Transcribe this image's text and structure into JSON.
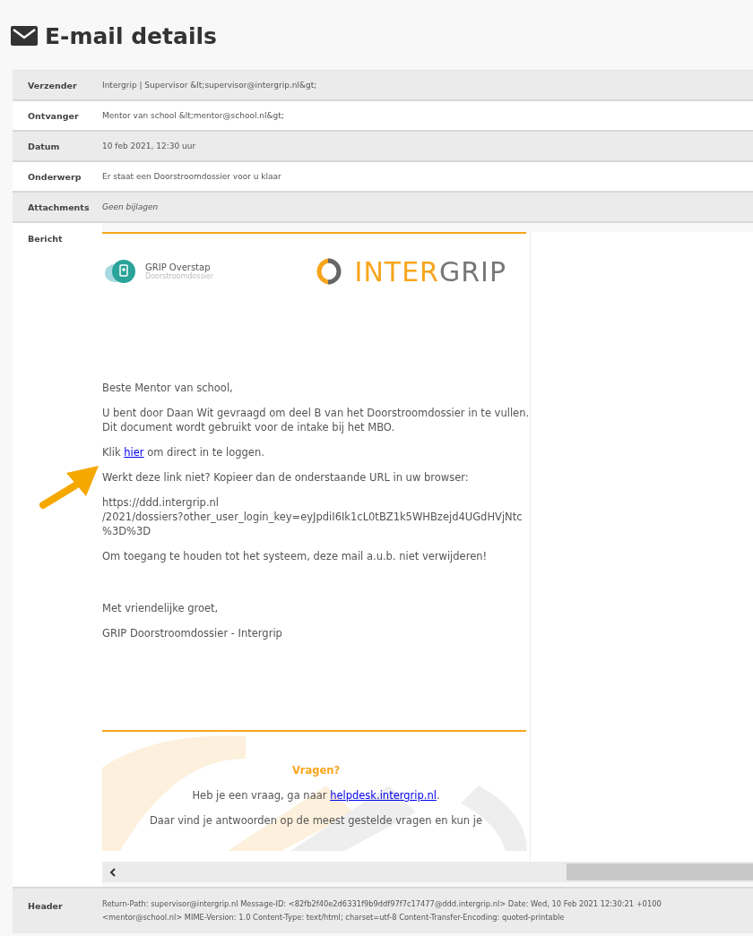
{
  "page_title": "E-mail details",
  "fields": [
    {
      "label": "Verzender",
      "value": "Intergrip | Supervisor &lt;supervisor@intergrip.nl&gt;",
      "kind": "text"
    },
    {
      "label": "Ontvanger",
      "value": "Mentor van school &lt;mentor@school.nl&gt;",
      "kind": "text"
    },
    {
      "label": "Datum",
      "value": "10 feb 2021, 12:30 uur",
      "kind": "text"
    },
    {
      "label": "Onderwerp",
      "value": "Er staat een Doorstroomdossier voor u klaar",
      "kind": "text"
    },
    {
      "label": "Attachments",
      "value": "Geen bijlagen",
      "kind": "none"
    }
  ],
  "message": {
    "label": "Bericht",
    "brand": {
      "name": "GRIP Overstap",
      "subtitle": "Doorstroomdossier",
      "wordmark": [
        "INTER",
        "GRIP"
      ]
    },
    "greeting": "Beste Mentor van school,",
    "intro": "U bent door Daan Wit gevraagd om deel B van het Doorstroomdossier in te vullen. Dit document wordt gebruikt voor de intake bij het MBO.",
    "login": {
      "before": "Klik ",
      "link": "hier",
      "after": " om direct in te loggen."
    },
    "fallback": "Werkt deze link niet? Kopieer dan de onderstaande URL in uw browser:",
    "url_lines": [
      "https://ddd.intergrip.nl",
      "/2021/dossiers?other_user_login_key=eyJpdiI6Ik1cL0tBZ1k5WHBzejd4UGdHVjNtc",
      "%3D%3D"
    ],
    "notice": "Om toegang te houden tot het systeem, deze mail a.u.b. niet verwijderen!",
    "closing": "Met vriendelijke groet,",
    "signature": "GRIP Doorstroomdossier - Intergrip",
    "footer": {
      "title": "Vragen?",
      "help_before": "Heb je een vraag, ga naar ",
      "help_link": "helpdesk.intergrip.nl",
      "help_after": ".",
      "more": "Daar vind je antwoorden op de meest gestelde vragen en kun je"
    }
  },
  "header": {
    "label": "Header",
    "lines": [
      "Return-Path: supervisor@intergrip.nl Message-ID: <82fb2f40e2d6331f9b9ddf97f7c17477@ddd.intergrip.nl> Date: Wed, 10 Feb 2021 12:30:21 +0100",
      "<mentor@school.nl> MIME-Version: 1.0 Content-Type: text/html; charset=utf-8 Content-Transfer-Encoding: quoted-printable"
    ]
  }
}
